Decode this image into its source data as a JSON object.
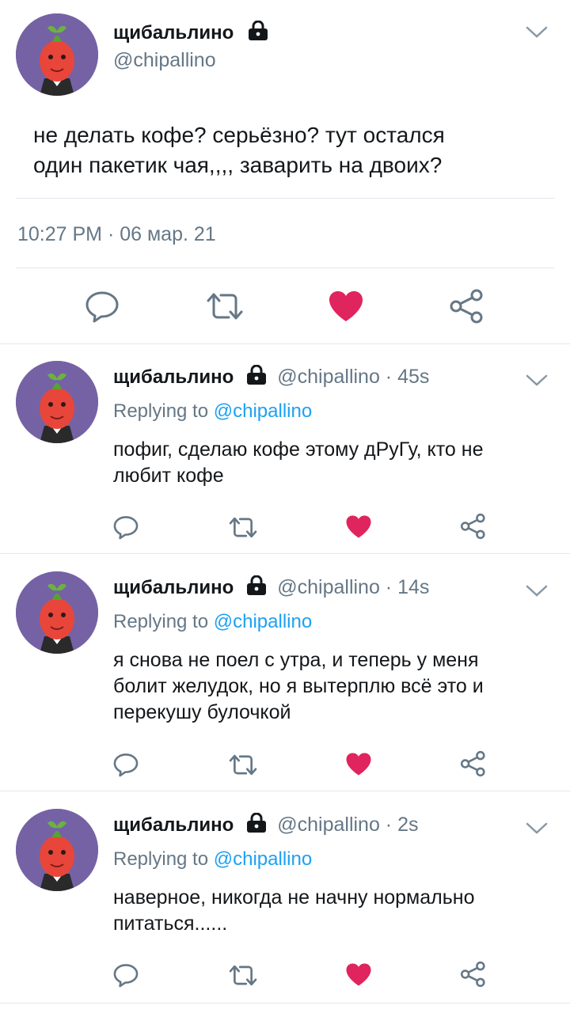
{
  "colors": {
    "text": "#14171a",
    "secondary": "#657786",
    "link": "#1da1f2",
    "like": "#e0245e",
    "divider": "#e1e8ed",
    "avatar_bg": "#7562a5"
  },
  "main_tweet": {
    "name": "щибальлино",
    "handle": "@chipallino",
    "text_line1": "не делать кофе? серьёзно? тут остался",
    "text_line2": "один пакетик чая,,,, заварить на двоих?",
    "timestamp": "10:27 PM · 06 мар. 21",
    "icons": [
      "lock-icon",
      "chevron-down-icon",
      "reply-icon",
      "retweet-icon",
      "like-icon-filled",
      "share-icon"
    ]
  },
  "replies": [
    {
      "name": "щибальлино",
      "handle": "@chipallino · 45s",
      "replying_prefix": "Replying to ",
      "replying_to": "@chipallino",
      "text_line1": "пофиг, сделаю кофе этому дРуГу, кто не",
      "text_line2": "любит кофе",
      "text_line3": ""
    },
    {
      "name": "щибальлино",
      "handle": "@chipallino · 14s",
      "replying_prefix": "Replying to ",
      "replying_to": "@chipallino",
      "text_line1": "я снова не поел с утра, и теперь у меня",
      "text_line2": "болит желудок, но я вытерплю всё это и",
      "text_line3": "перекушу булочкой"
    },
    {
      "name": "щибальлино",
      "handle": "@chipallino · 2s",
      "replying_prefix": "Replying to ",
      "replying_to": "@chipallino",
      "text_line1": "наверное, никогда не начну нормально",
      "text_line2": "питаться......",
      "text_line3": ""
    }
  ]
}
